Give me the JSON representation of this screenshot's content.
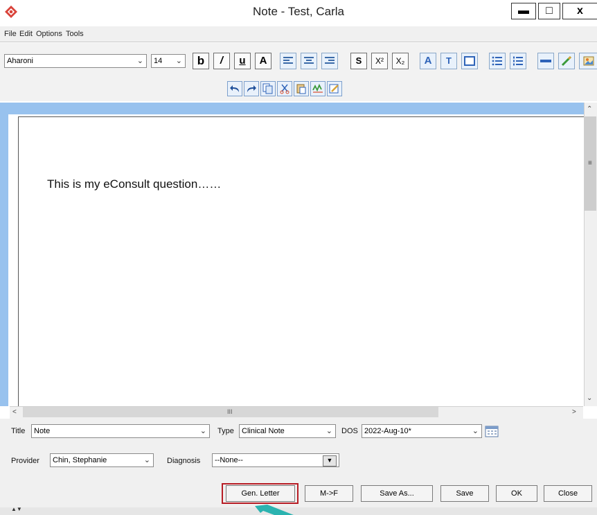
{
  "window": {
    "title": "Note - Test, Carla",
    "minimize_glyph": "▬",
    "maximize_glyph": "□",
    "close_glyph": "x",
    "app_icon": "red-diamond-logo-icon"
  },
  "menu": {
    "items": [
      "File",
      "Edit",
      "Options",
      "Tools"
    ]
  },
  "toolbar": {
    "font_family": "Aharoni",
    "font_size": "14",
    "bold_label": "b",
    "italic_label": "/",
    "underline_label": "u",
    "font_color_label": "A",
    "strike_label": "S",
    "superscript_label": "X²",
    "subscript_label": "X₂",
    "highlight_label": "A",
    "textbox_label": "T",
    "icons_row2": [
      "undo-icon",
      "redo-icon",
      "copy-icon",
      "cut-icon",
      "paste-icon",
      "spellcheck-icon",
      "edit-icon"
    ]
  },
  "editor": {
    "body_text": "This is my eConsult question……",
    "hscroll_grip": "III"
  },
  "form": {
    "title_label": "Title",
    "title_value": "Note",
    "type_label": "Type",
    "type_value": "Clinical Note",
    "dos_label": "DOS",
    "dos_value": "2022-Aug-10*",
    "provider_label": "Provider",
    "provider_value": "Chin, Stephanie",
    "diagnosis_label": "Diagnosis",
    "diagnosis_value": "--None--"
  },
  "buttons": {
    "gen_letter": "Gen. Letter",
    "m_to_f": "M->F",
    "save_as": "Save As...",
    "save": "Save",
    "ok": "OK",
    "close": "Close"
  },
  "colors": {
    "editor_frame": "#98c2ee",
    "highlight_border": "#b71c24",
    "pointer_arrow": "#2bb3b0"
  }
}
